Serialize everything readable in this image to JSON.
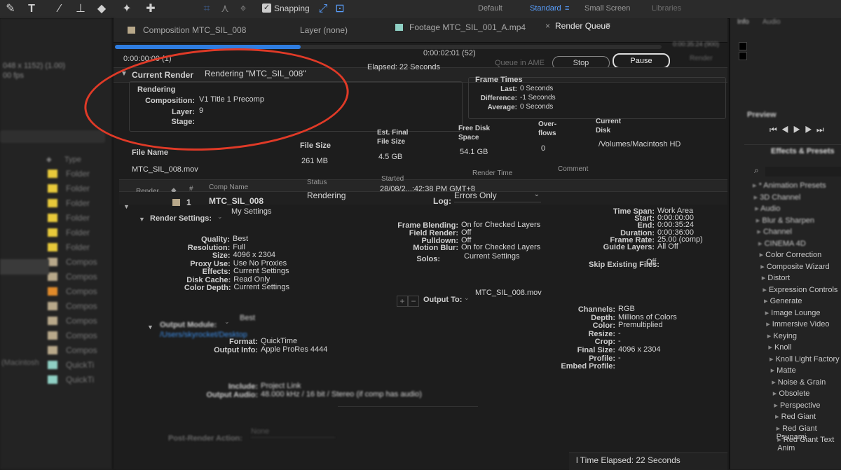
{
  "toolbar": {
    "snapping_label": "Snapping",
    "workspaces": [
      "Default",
      "Standard",
      "Small Screen",
      "Libraries"
    ],
    "active_workspace": "Standard"
  },
  "left_panel": {
    "info_lines": [
      "048 x 1152) (1.00)",
      "00 fps"
    ],
    "type_header": "Type",
    "rows": [
      {
        "type": "Folder",
        "color": "#e8c93a"
      },
      {
        "type": "Folder",
        "color": "#e8c93a"
      },
      {
        "type": "Folder",
        "color": "#e8c93a"
      },
      {
        "type": "Folder",
        "color": "#e8c93a"
      },
      {
        "type": "Folder",
        "color": "#e8c93a"
      },
      {
        "type": "Folder",
        "color": "#e8c93a"
      },
      {
        "type": "Compos",
        "color": "#b8a88a"
      },
      {
        "type": "Compos",
        "color": "#b8a88a"
      },
      {
        "type": "Compos",
        "color": "#e08a2a"
      },
      {
        "type": "Compos",
        "color": "#b8a88a"
      },
      {
        "type": "Compos",
        "color": "#b8a88a"
      },
      {
        "type": "Compos",
        "color": "#b8a88a"
      },
      {
        "type": "Compos",
        "color": "#b8a88a"
      },
      {
        "type": "QuickTi",
        "color": "#8fd0c4"
      },
      {
        "type": "QuickTi",
        "color": "#8fd0c4"
      }
    ],
    "bottom_label": "(Macintosh"
  },
  "tabs": {
    "composition": "Composition MTC_SIL_008",
    "layer": "Layer (none)",
    "footage": "Footage MTC_SIL_001_A.mp4",
    "render_queue": "Render Queue"
  },
  "progress": {
    "fraction": 0.34,
    "start_time": "0:00:00:00 (1)",
    "current_time": "0:00:02:01 (52)",
    "end_time": "0:00:35:24 (900)"
  },
  "buttons": {
    "queue_in_ame": "Queue in AME",
    "stop": "Stop",
    "pause": "Pause",
    "render": "Render"
  },
  "current_render": {
    "title": "Current Render",
    "rendering_status": "Rendering \"MTC_SIL_008\"",
    "elapsed": "Elapsed: 22 Seconds",
    "rendering_header": "Rendering",
    "composition_label": "Composition:",
    "composition_value": "V1 Title 1 Precomp",
    "layer_label": "Layer:",
    "layer_value": "9",
    "stage_label": "Stage:",
    "stage_value": ""
  },
  "frame_times": {
    "title": "Frame Times",
    "last_label": "Last:",
    "last_value": "0 Seconds",
    "difference_label": "Difference:",
    "difference_value": "-1 Seconds",
    "average_label": "Average:",
    "average_value": "0 Seconds"
  },
  "file_stats": {
    "file_name_header": "File Name",
    "file_name": "MTC_SIL_008.mov",
    "file_size_header": "File Size",
    "file_size": "261 MB",
    "est_final_header_1": "Est. Final",
    "est_final_header_2": "File Size",
    "est_final": "4.5 GB",
    "free_disk_header_1": "Free Disk",
    "free_disk_header_2": "Space",
    "free_disk": "54.1 GB",
    "overflows_header_1": "Over-",
    "overflows_header_2": "flows",
    "overflows": "0",
    "current_disk_header_1": "Current",
    "current_disk_header_2": "Disk",
    "current_disk": "/Volumes/Macintosh HD"
  },
  "queue_columns": {
    "render": "Render",
    "number": "#",
    "comp_name": "Comp Name",
    "status": "Status",
    "started": "Started",
    "render_time": "Render Time",
    "comment": "Comment"
  },
  "queue_item": {
    "number": "1",
    "comp_name": "MTC_SIL_008",
    "status": "Rendering",
    "started": "28/08/2...:42:38 PM GMT+8",
    "render_time": "-",
    "log_label": "Log:",
    "log_value": "Errors Only"
  },
  "render_settings": {
    "label": "Render Settings:",
    "value": "My Settings",
    "quality_label": "Quality:",
    "quality": "Best",
    "resolution_label": "Resolution:",
    "resolution": "Full",
    "size_label": "Size:",
    "size": "4096 x 2304",
    "proxy_label": "Proxy Use:",
    "proxy": "Use No Proxies",
    "effects_label": "Effects:",
    "effects": "Current Settings",
    "disk_cache_label": "Disk Cache:",
    "disk_cache": "Read Only",
    "color_depth_label": "Color Depth:",
    "color_depth": "Current Settings",
    "frame_blending_label": "Frame Blending:",
    "frame_blending": "On for Checked Layers",
    "field_render_label": "Field Render:",
    "field_render": "Off",
    "pulldown_label": "Pulldown:",
    "pulldown": "Off",
    "motion_blur_label": "Motion Blur:",
    "motion_blur": "On for Checked Layers",
    "solos_label": "Solos:",
    "solos": "Current Settings",
    "time_span_label": "Time Span:",
    "time_span": "Work Area",
    "start_label": "Start:",
    "start": "0:00:00:00",
    "end_label": "End:",
    "end": "0:00:35:24",
    "duration_label": "Duration:",
    "duration": "0:00:36:00",
    "frame_rate_label": "Frame Rate:",
    "frame_rate": "25.00 (comp)",
    "guide_layers_label": "Guide Layers:",
    "guide_layers": "All Off",
    "skip_existing_label": "Skip Existing Files:",
    "skip_existing": "Off"
  },
  "output_module": {
    "label": "Output Module:",
    "value": "Best",
    "path": "/Users/skyrocket/Desktop",
    "output_to_label": "Output To:",
    "output_to": "MTC_SIL_008.mov",
    "format_label": "Format:",
    "format": "QuickTime",
    "output_info_label": "Output Info:",
    "output_info": "Apple ProRes 4444",
    "channels_label": "Channels:",
    "channels": "RGB",
    "depth_label": "Depth:",
    "depth": "Millions of Colors",
    "color_label": "Color:",
    "color": "Premultiplied",
    "resize_label": "Resize:",
    "resize": "-",
    "crop_label": "Crop:",
    "crop": "-",
    "final_size_label": "Final Size:",
    "final_size": "4096 x 2304",
    "profile_label": "Profile:",
    "profile": "-",
    "embed_profile_label": "Embed Profile:",
    "embed_profile": "",
    "include_label": "Include:",
    "include": "Project Link",
    "output_audio_label": "Output Audio:",
    "output_audio": "48.000 kHz / 16 bit / Stereo (if comp has audio)",
    "post_render_label": "Post-Render Action:",
    "post_render": "None"
  },
  "footer": {
    "elapsed": "l Time Elapsed: 22 Seconds"
  },
  "right_panel": {
    "top_tabs": [
      "Info",
      "Audio"
    ],
    "preview_title": "Preview",
    "effects_title": "Effects & Presets",
    "effects": [
      "* Animation Presets",
      "3D Channel",
      "Audio",
      "Blur & Sharpen",
      "Channel",
      "CINEMA 4D",
      "Color Correction",
      "Composite Wizard",
      "Distort",
      "Expression Controls",
      "Generate",
      "Image Lounge",
      "Immersive Video",
      "Keying",
      "Knoll",
      "Knoll Light Factory",
      "Matte",
      "Noise & Grain",
      "Obsolete",
      "Perspective",
      "Red Giant",
      "Red Giant Psunami",
      "Red Giant Text Anim"
    ]
  }
}
